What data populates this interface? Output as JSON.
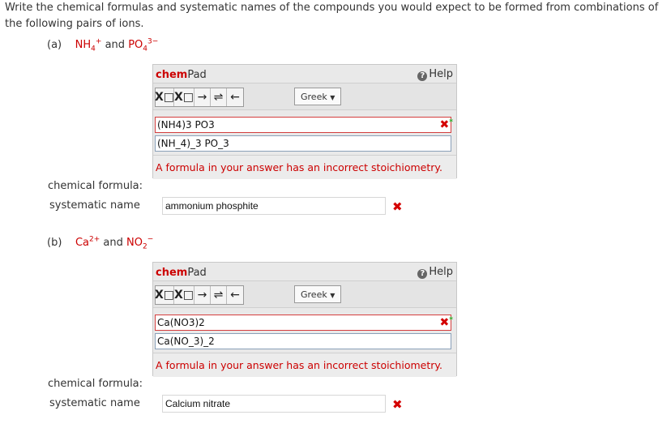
{
  "intro": "Write the chemical formulas and systematic names of the compounds you would expect to be formed from combinations of the following pairs of ions.",
  "parts": [
    {
      "label": "(a)",
      "ion1": {
        "base": "NH",
        "sub": "4",
        "sup": "+"
      },
      "and": "and",
      "ion2": {
        "base": "PO",
        "sub": "4",
        "sup": "3−"
      },
      "chempad": {
        "title_chem": "chem",
        "title_pad": "Pad",
        "help": "Help",
        "toolbar": {
          "sub_btn": "X□",
          "sup_btn": "X□",
          "arrow": "→",
          "equilibrium": "⇌",
          "back": "←"
        },
        "greek": "Greek",
        "rendered": "(NH4)3 PO3",
        "raw": "(NH_4)_3 PO_3",
        "message": "A formula in your answer has an incorrect stoichiometry."
      },
      "formula_label": "chemical formula:",
      "name_label": "systematic name",
      "name_value": "ammonium phosphite"
    },
    {
      "label": "(b)",
      "ion1": {
        "base": "Ca",
        "sub": "",
        "sup": "2+"
      },
      "and": "and",
      "ion2": {
        "base": "NO",
        "sub": "2",
        "sup": "−"
      },
      "chempad": {
        "title_chem": "chem",
        "title_pad": "Pad",
        "help": "Help",
        "toolbar": {
          "sub_btn": "X□",
          "sup_btn": "X□",
          "arrow": "→",
          "equilibrium": "⇌",
          "back": "←"
        },
        "greek": "Greek",
        "rendered": "Ca(NO3)2",
        "raw": "Ca(NO_3)_2",
        "message": "A formula in your answer has an incorrect stoichiometry."
      },
      "formula_label": "chemical formula:",
      "name_label": "systematic name",
      "name_value": "Calcium nitrate"
    }
  ],
  "icons": {
    "help": "?",
    "wrong": "✖",
    "star": "*"
  }
}
